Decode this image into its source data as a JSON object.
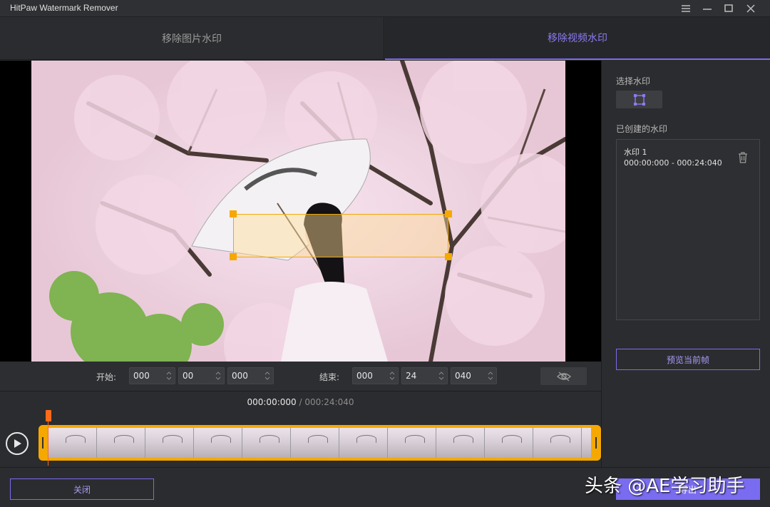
{
  "app": {
    "title": "HitPaw Watermark Remover"
  },
  "window": {
    "menu_icon": "hamburger-menu-icon",
    "minimize_icon": "minimize-icon",
    "maximize_icon": "maximize-icon",
    "close_icon": "close-icon"
  },
  "tabs": [
    {
      "label": "移除图片水印",
      "active": false
    },
    {
      "label": "移除视频水印",
      "active": true
    }
  ],
  "range": {
    "start_label": "开始:",
    "start": [
      "000",
      "00",
      "000"
    ],
    "end_label": "结束:",
    "end": [
      "000",
      "24",
      "040"
    ],
    "visibility_icon": "eye-hidden-icon"
  },
  "timeline": {
    "current": "000:00:000",
    "separator": " / ",
    "total": "000:24:040",
    "play_icon": "play-icon"
  },
  "sidebar": {
    "select_label": "选择水印",
    "select_tool_icon": "selection-rectangle-icon",
    "created_label": "已创建的水印",
    "watermarks": [
      {
        "name": "水印 1",
        "range": "000:00:000 - 000:24:040",
        "delete_icon": "trash-icon"
      }
    ],
    "preview_button": "预览当前帧"
  },
  "footer": {
    "close_button": "关闭",
    "export_button": "导出",
    "overlay_text": "头条 @AE学习助手"
  },
  "colors": {
    "accent": "#7a6cf0",
    "selection": "#f5a800",
    "playhead": "#ff6a1a"
  }
}
